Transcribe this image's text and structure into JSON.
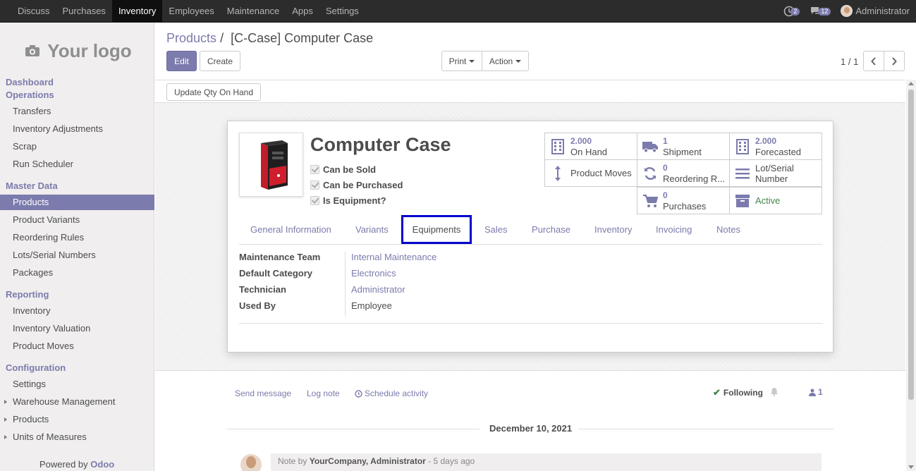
{
  "topbar": {
    "menu": [
      "Discuss",
      "Purchases",
      "Inventory",
      "Employees",
      "Maintenance",
      "Apps",
      "Settings"
    ],
    "activity_count": "2",
    "messages_count": "12",
    "user": "Administrator"
  },
  "sidebar": {
    "logo_text": "Your logo",
    "dashboard": "Dashboard",
    "operations": "Operations",
    "operations_items": [
      "Transfers",
      "Inventory Adjustments",
      "Scrap",
      "Run Scheduler"
    ],
    "master_data": "Master Data",
    "master_data_items": [
      "Products",
      "Product Variants",
      "Reordering Rules",
      "Lots/Serial Numbers",
      "Packages"
    ],
    "reporting": "Reporting",
    "reporting_items": [
      "Inventory",
      "Inventory Valuation",
      "Product Moves"
    ],
    "configuration": "Configuration",
    "configuration_items": [
      "Settings",
      "Warehouse Management",
      "Products",
      "Units of Measures"
    ],
    "powered_by": "Powered by",
    "powered_brand": "Odoo"
  },
  "control": {
    "breadcrumb_parent": "Products",
    "breadcrumb_sep": "/",
    "breadcrumb_current": "[C-Case] Computer Case",
    "edit_label": "Edit",
    "create_label": "Create",
    "print_label": "Print",
    "action_label": "Action",
    "pager": "1 / 1"
  },
  "statusbar": {
    "update_qty_label": "Update Qty On Hand"
  },
  "product": {
    "name": "Computer Case",
    "can_be_sold": "Can be Sold",
    "can_be_purchased": "Can be Purchased",
    "is_equipment": "Is Equipment?"
  },
  "stats": {
    "on_hand_value": "2.000",
    "on_hand_label": "On Hand",
    "shipment_value": "1",
    "shipment_label": "Shipment",
    "forecasted_value": "2.000",
    "forecasted_label": "Forecasted",
    "product_moves_label": "Product Moves",
    "reordering_value": "0",
    "reordering_label": "Reordering R...",
    "lot_label_1": "Lot/Serial",
    "lot_label_2": "Number",
    "purchases_value": "0",
    "purchases_label": "Purchases",
    "active_label": "Active"
  },
  "tabs": [
    "General Information",
    "Variants",
    "Equipments",
    "Sales",
    "Purchase",
    "Inventory",
    "Invoicing",
    "Notes"
  ],
  "equipment_fields": {
    "maintenance_team_label": "Maintenance Team",
    "maintenance_team_value": "Internal Maintenance",
    "default_category_label": "Default Category",
    "default_category_value": "Electronics",
    "technician_label": "Technician",
    "technician_value": "Administrator",
    "used_by_label": "Used By",
    "used_by_value": "Employee"
  },
  "chatter": {
    "send_message": "Send message",
    "log_note": "Log note",
    "schedule_activity": "Schedule activity",
    "following": "Following",
    "followers_count": "1",
    "date": "December 10, 2021",
    "note_prefix": "Note by",
    "note_author": "YourCompany, Administrator",
    "note_time": "- 5 days ago"
  },
  "colors": {
    "brand": "#7c7bad",
    "topbar": "#2c2c2c",
    "active_green": "#44874d",
    "highlight_border": "#0000cc"
  }
}
